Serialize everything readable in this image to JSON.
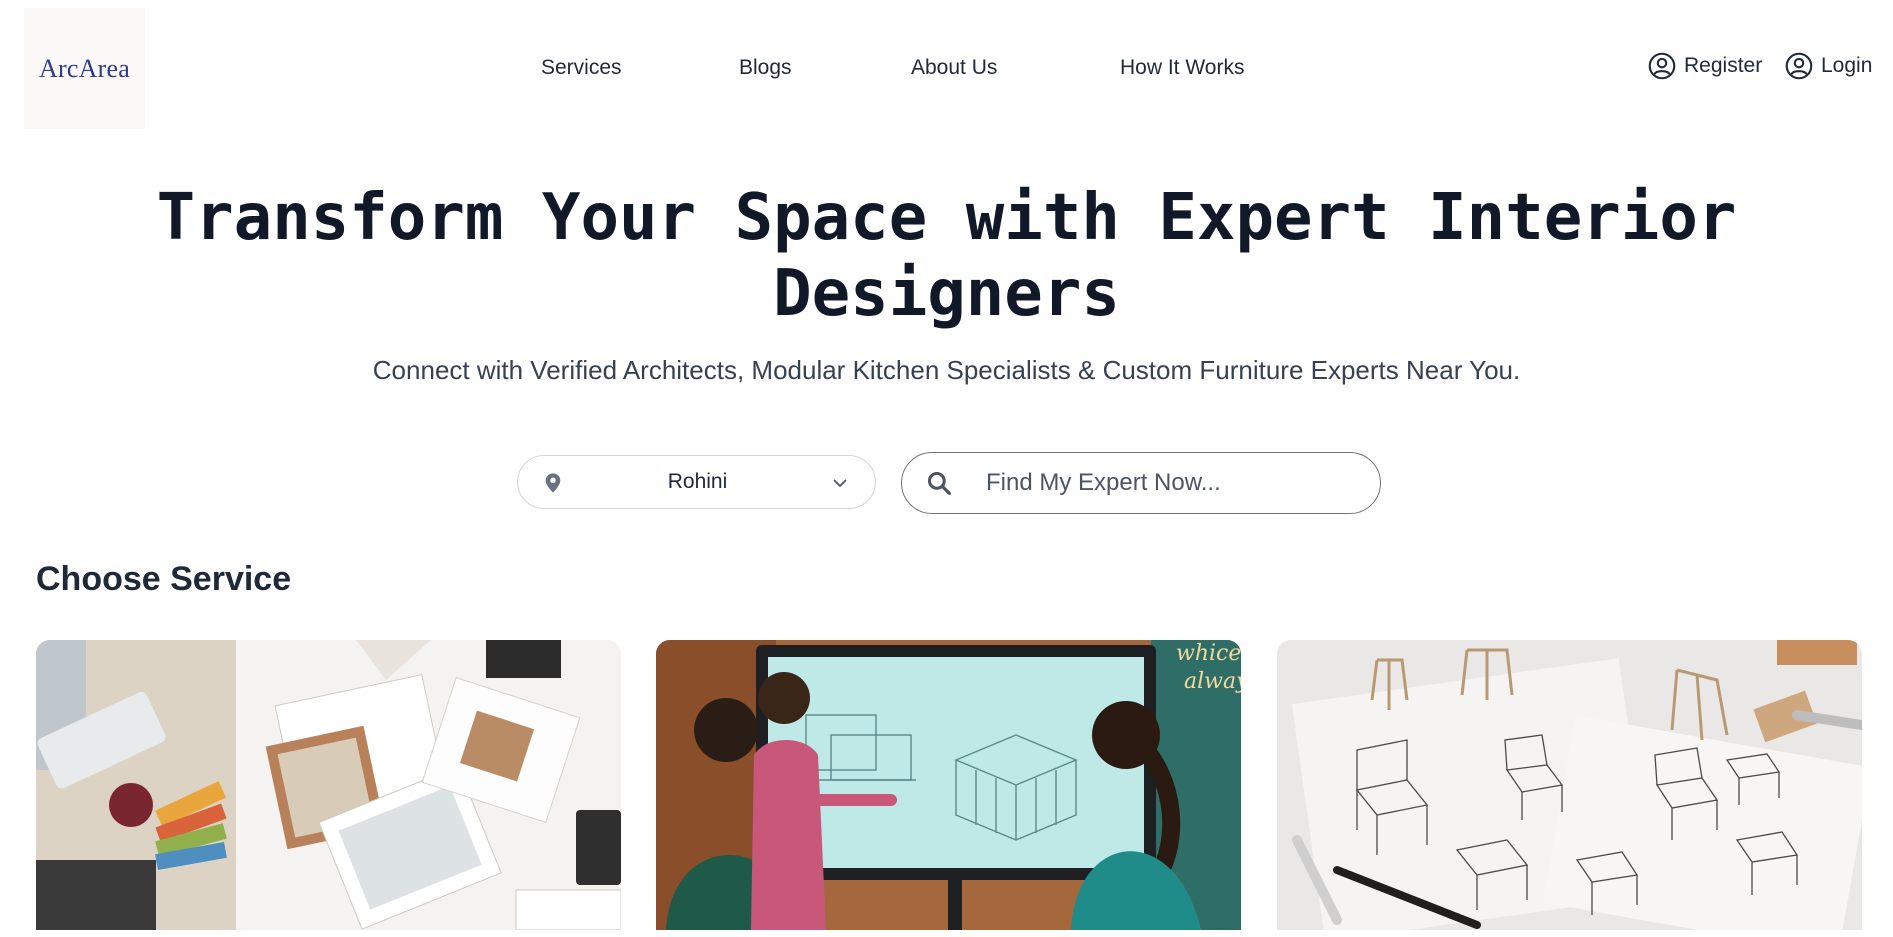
{
  "header": {
    "logo_text": "ArcArea",
    "nav": [
      {
        "label": "Services"
      },
      {
        "label": "Blogs"
      },
      {
        "label": "About Us"
      },
      {
        "label": "How It Works"
      }
    ],
    "register_label": "Register",
    "login_label": "Login"
  },
  "hero": {
    "title_line1": "Transform Your Space with Expert Interior",
    "title_line2": "Designers",
    "subtitle": "Connect with Verified Architects, Modular Kitchen Specialists & Custom Furniture Experts Near You."
  },
  "search": {
    "location_value": "Rohini",
    "placeholder": "Find My Expert Now..."
  },
  "services": {
    "heading": "Choose Service",
    "cards": [
      {
        "image": "interior-design-desk-photo"
      },
      {
        "image": "architect-presentation-photo"
      },
      {
        "image": "furniture-sketches-photo"
      }
    ]
  },
  "colors": {
    "logo": "#2e3a8c",
    "heading": "#111827",
    "text": "#1f2937"
  }
}
